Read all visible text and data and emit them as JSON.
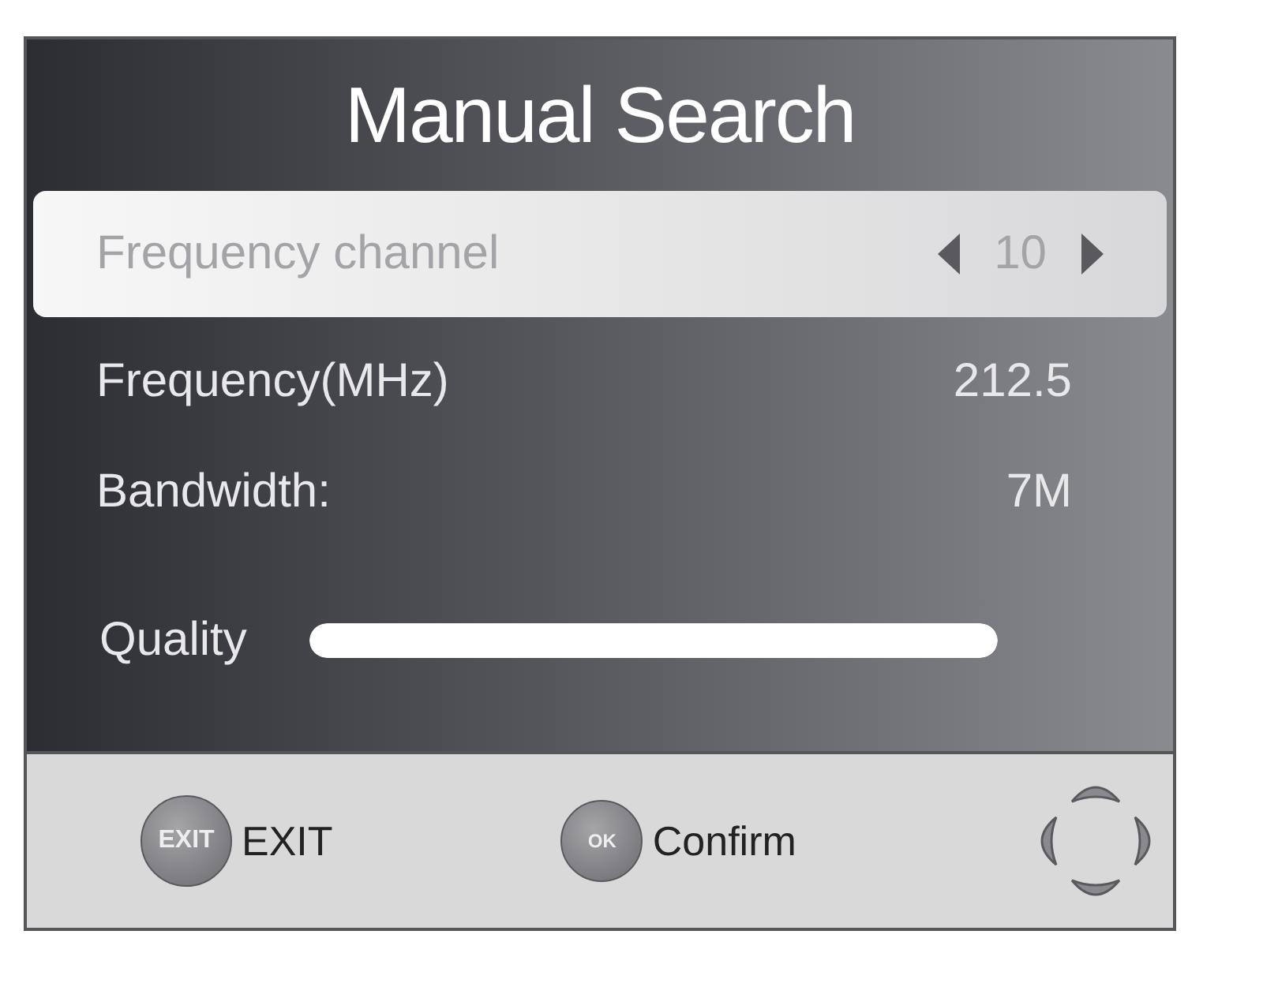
{
  "title": "Manual Search",
  "rows": [
    {
      "kind": "selector",
      "label": "Frequency channel",
      "value": "10",
      "selected": true
    },
    {
      "kind": "value",
      "label": "Frequency(MHz)",
      "value": "212.5",
      "selected": false
    },
    {
      "kind": "value",
      "label": "Bandwidth:",
      "value": "7M",
      "selected": false
    }
  ],
  "quality": {
    "label": "Quality",
    "level": 1
  },
  "footer": [
    {
      "kind": "key",
      "key": "EXIT",
      "label": "EXIT"
    },
    {
      "kind": "key",
      "key": "OK",
      "label": "Confirm"
    },
    {
      "kind": "dpad"
    }
  ]
}
